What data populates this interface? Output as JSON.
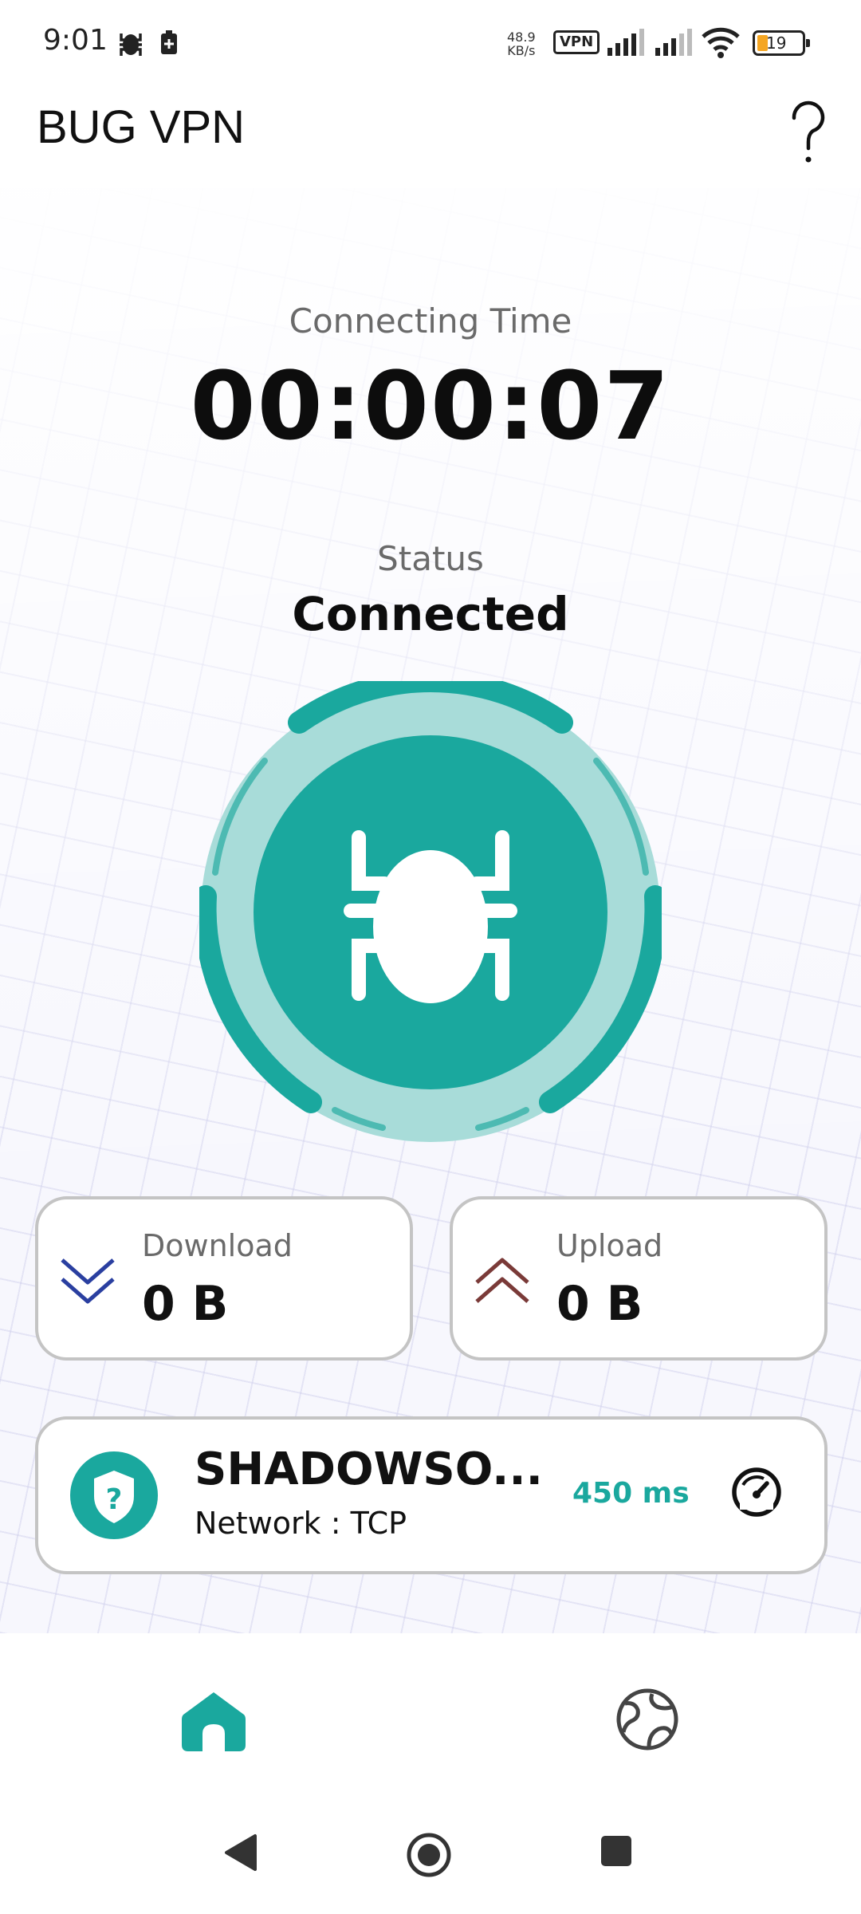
{
  "status_bar": {
    "time": "9:01",
    "net_speed_value": "48.9",
    "net_speed_unit": "KB/s",
    "vpn_badge": "VPN",
    "battery_level": "19"
  },
  "app_bar": {
    "title": "BUG VPN",
    "help_icon": "question-mark-icon"
  },
  "connection": {
    "time_label": "Connecting Time",
    "time_value": "00:00:07",
    "status_label": "Status",
    "status_value": "Connected"
  },
  "stats": {
    "download_label": "Download",
    "download_value": "0 B",
    "upload_label": "Upload",
    "upload_value": "0 B"
  },
  "server": {
    "name": "SHADOWSO...",
    "network": "Network : TCP",
    "ping": "450 ms",
    "shield_glyph": "?"
  },
  "bottom_nav": {
    "items": [
      {
        "icon": "home-icon",
        "active": true
      },
      {
        "icon": "globe-icon",
        "active": false
      }
    ]
  },
  "colors": {
    "accent": "#1aa89e",
    "accent_light": "#a8dcd9",
    "download_icon": "#2a3fa0",
    "upload_icon": "#7a3a38"
  }
}
